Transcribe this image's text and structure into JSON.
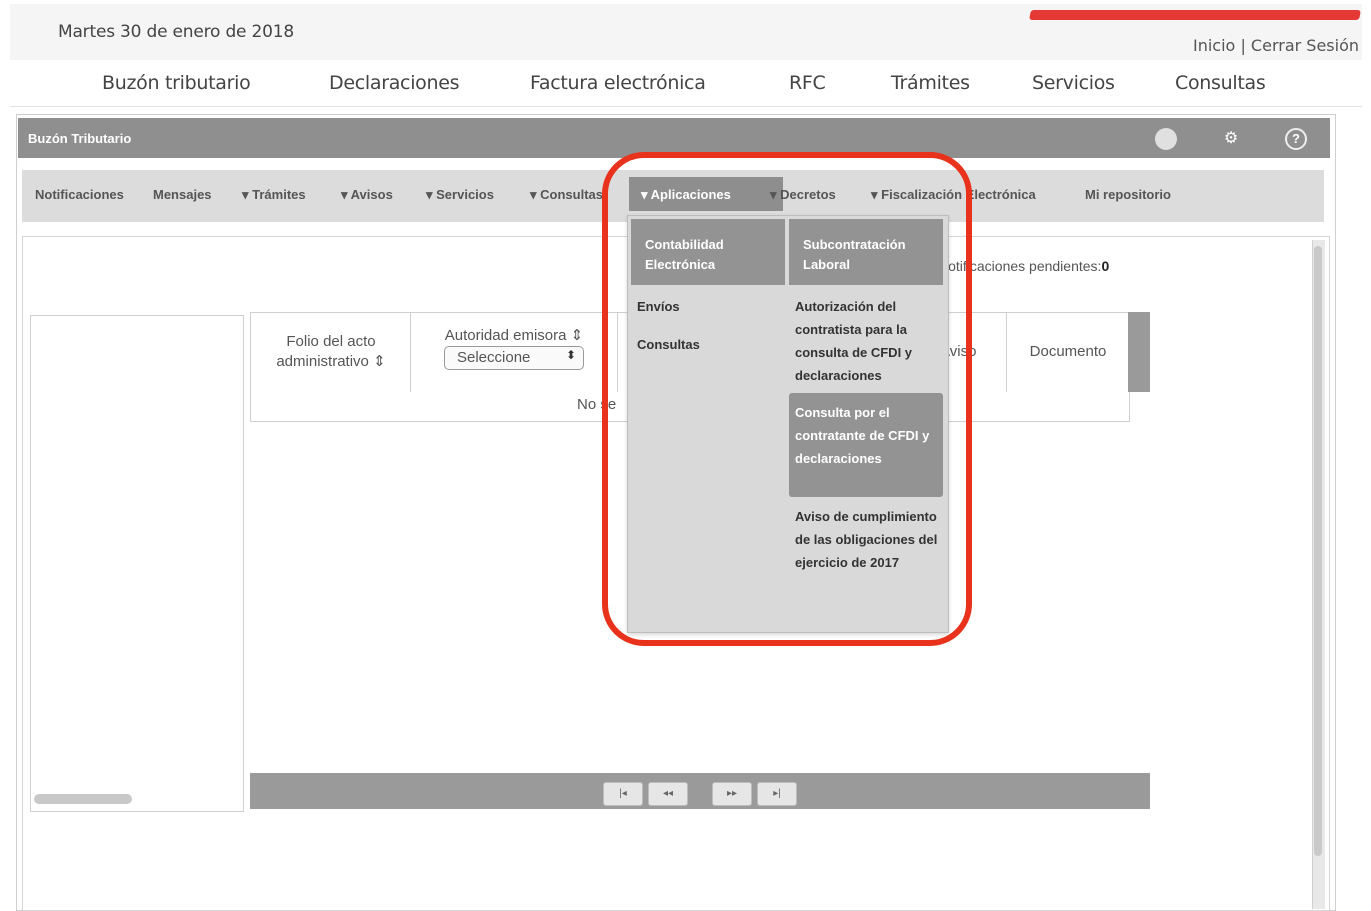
{
  "header": {
    "date": "Martes 30 de enero de 2018",
    "links": [
      "Inicio",
      "Cerrar Sesión"
    ],
    "separator": "|"
  },
  "main_nav": {
    "items": [
      "Buzón tributario",
      "Declaraciones",
      "Factura electrónica",
      "RFC",
      "Trámites",
      "Servicios",
      "Consultas"
    ]
  },
  "panel": {
    "title": "Buzón Tributario",
    "icons": [
      "circle-icon",
      "gear-icon",
      "help-icon"
    ]
  },
  "sub_nav": {
    "notificaciones": "Notificaciones",
    "mensajes": "Mensajes",
    "tramites": "Trámites",
    "avisos": "Avisos",
    "servicios": "Servicios",
    "consultas": "Consultas",
    "aplicaciones": "Aplicaciones",
    "decretos": "Decretos",
    "fiscalizacion": "Fiscalización Electrónica",
    "repositorio": "Mi repositorio"
  },
  "dropdown": {
    "col1": {
      "header": "Contabilidad Electrónica",
      "items": [
        "Envíos",
        "Consultas"
      ]
    },
    "col2": {
      "header": "Subcontratación Laboral",
      "items": [
        "Autorización del contratista para la consulta de CFDI y declaraciones",
        "Consulta por el contratante de CFDI y declaraciones",
        "Aviso de cumplimiento de las obligaciones del ejercicio de 2017"
      ]
    }
  },
  "content": {
    "pending_label": "Notificaciones pendientes:",
    "pending_count": "0"
  },
  "table": {
    "col_folio": "Folio del acto administrativo",
    "col_autoridad": "Autoridad emisora",
    "select_value": "Seleccione",
    "col_aviso": "Aviso",
    "col_documento": "Documento",
    "empty_text": "No se"
  },
  "pager": {
    "first": "|◂",
    "prev": "◂◂",
    "next": "▸▸",
    "last": "▸|"
  },
  "colors": {
    "annotation": "#e8321c",
    "title_bar": "#8f8f8f",
    "sub_nav_bg": "#dcdcdc"
  }
}
